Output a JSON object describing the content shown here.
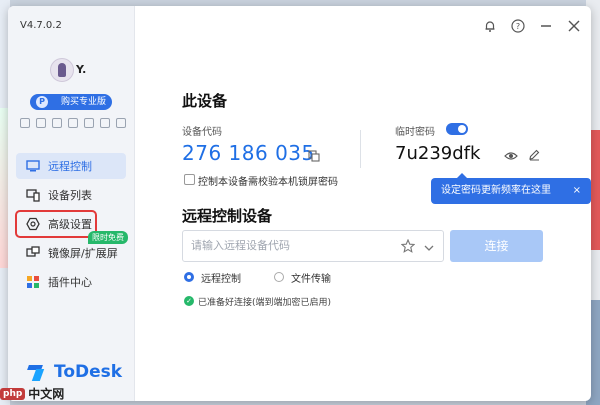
{
  "app": {
    "version": "V4.7.0.2",
    "username": "Y.",
    "pro_button": "购买专业版",
    "pro_badge": "P",
    "logo_text": "ToDesk"
  },
  "sidebar": {
    "items": [
      {
        "label": "远程控制",
        "icon": "monitor-icon",
        "active": true
      },
      {
        "label": "设备列表",
        "icon": "devices-icon"
      },
      {
        "label": "高级设置",
        "icon": "settings-hexagon-icon",
        "highlighted": true
      },
      {
        "label": "镜像屏/扩展屏",
        "icon": "mirror-screen-icon",
        "tag": "限时免费"
      },
      {
        "label": "插件中心",
        "icon": "plugin-icon"
      }
    ]
  },
  "titlebar": {
    "icons": [
      "bell-icon",
      "help-icon",
      "minimize-icon",
      "close-icon"
    ]
  },
  "this_device": {
    "title": "此设备",
    "code_label": "设备代码",
    "code": "276 186 035",
    "temp_pw_label": "临时密码",
    "temp_pw": "7u239dfk",
    "temp_pw_enabled": true,
    "lock_checkbox_label": "控制本设备需校验本机锁屏密码",
    "lock_checkbox_checked": false
  },
  "tooltip": {
    "text": "设定密码更新频率在这里",
    "close": "×"
  },
  "remote": {
    "title": "远程控制设备",
    "input_placeholder": "请输入远程设备代码",
    "connect_label": "连接",
    "modes": [
      {
        "label": "远程控制",
        "selected": true
      },
      {
        "label": "文件传输",
        "selected": false
      }
    ],
    "status": "已准备好连接(端到端加密已启用)"
  },
  "watermark": {
    "badge": "php",
    "text": "中文网"
  },
  "colors": {
    "accent": "#2f6fe4",
    "highlight_border": "#e23a3a",
    "free_tag": "#26b86a"
  }
}
